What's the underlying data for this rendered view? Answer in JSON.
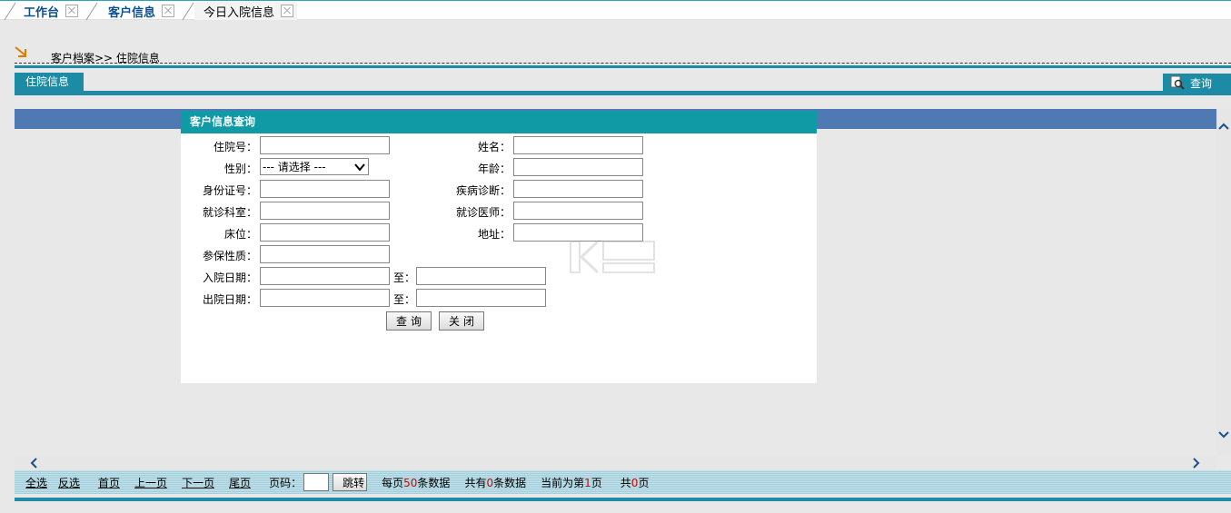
{
  "tabs": [
    {
      "label": "工作台",
      "active": false
    },
    {
      "label": "客户信息",
      "active": false
    },
    {
      "label": "今日入院信息",
      "active": true
    }
  ],
  "breadcrumb": "客户档案>> 住院信息",
  "section": {
    "tab_label": "住院信息",
    "query_label": "查询"
  },
  "dialog": {
    "title": "客户信息查询",
    "fields": {
      "admission_no": {
        "label": "住院号：",
        "value": ""
      },
      "name": {
        "label": "姓名：",
        "value": ""
      },
      "gender": {
        "label": "性别：",
        "selected": "--- 请选择 ---"
      },
      "age": {
        "label": "年龄：",
        "value": ""
      },
      "id_card": {
        "label": "身份证号：",
        "value": ""
      },
      "diagnosis": {
        "label": "疾病诊断：",
        "value": ""
      },
      "department": {
        "label": "就诊科室：",
        "value": ""
      },
      "doctor": {
        "label": "就诊医师：",
        "value": ""
      },
      "bed": {
        "label": "床位：",
        "value": ""
      },
      "address": {
        "label": "地址：",
        "value": ""
      },
      "insurance": {
        "label": "参保性质：",
        "value": ""
      },
      "admit_date": {
        "label": "入院日期：",
        "to_label": "至：",
        "from": "",
        "to": ""
      },
      "discharge_date": {
        "label": "出院日期：",
        "to_label": "至：",
        "from": "",
        "to": ""
      }
    },
    "buttons": {
      "query": "查询",
      "close": "关闭"
    }
  },
  "pager": {
    "select_all": "全选",
    "invert": "反选",
    "first": "首页",
    "prev": "上一页",
    "next": "下一页",
    "last": "尾页",
    "page_no_label": "页码：",
    "page_no_value": "",
    "go": "跳转",
    "per_page_prefix": "每页",
    "per_page": "50",
    "per_page_suffix": "条数据",
    "total_prefix": "共有",
    "total": "0",
    "total_suffix": "条数据",
    "current_prefix": "当前为第",
    "current": "1",
    "current_suffix": "页",
    "pages_prefix": "共",
    "pages": "0",
    "pages_suffix": "页"
  },
  "colors": {
    "accent_teal": "#1b8ba6",
    "dialog_title": "#0f9aa5",
    "result_header": "#4f79b3",
    "highlight_red": "#d40000"
  }
}
